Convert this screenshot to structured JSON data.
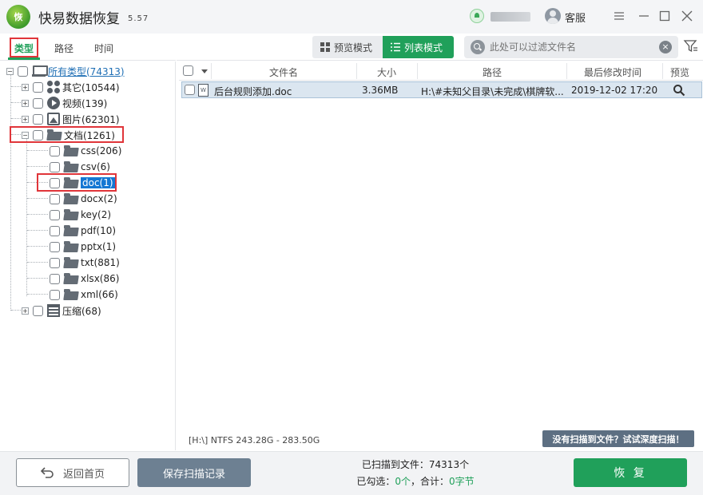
{
  "app": {
    "logo_text": "恢",
    "title": "快易数据恢复",
    "version": "5.57",
    "customer_service": "客服"
  },
  "left_tabs": [
    "类型",
    "路径",
    "时间"
  ],
  "tree": {
    "root": "所有类型(74313)",
    "categories": [
      {
        "label": "其它(10544)",
        "icon": "apps-icon"
      },
      {
        "label": "视频(139)",
        "icon": "video-icon"
      },
      {
        "label": "图片(62301)",
        "icon": "image-icon"
      },
      {
        "label": "文档(1261)",
        "icon": "folder-icon"
      },
      {
        "label": "压缩(68)",
        "icon": "archive-icon"
      }
    ],
    "document_children": [
      "css(206)",
      "csv(6)",
      "doc(1)",
      "docx(2)",
      "key(2)",
      "pdf(10)",
      "pptx(1)",
      "txt(881)",
      "xlsx(86)",
      "xml(66)"
    ],
    "selected": "doc(1)"
  },
  "toolbar": {
    "preview_mode": "预览模式",
    "list_mode": "列表模式",
    "search_placeholder": "此处可以过滤文件名"
  },
  "table": {
    "columns": [
      "文件名",
      "大小",
      "路径",
      "最后修改时间",
      "预览"
    ],
    "rows": [
      {
        "name": "后台规则添加.doc",
        "size": "3.36MB",
        "path": "H:\\#未知父目录\\未完成\\棋牌软...",
        "modified": "2019-12-02  17:20"
      }
    ]
  },
  "status": {
    "path_info": "[H:\\] NTFS 243.28G - 283.50G",
    "deep_scan": "没有扫描到文件？试试深度扫描！"
  },
  "footer": {
    "home_button": "返回首页",
    "save_button": "保存扫描记录",
    "scanned_label": "已扫描到文件：",
    "scanned_count": "74313个",
    "checked_label": "已勾选：",
    "checked_count": "0个",
    "total_label": "，合计：",
    "total_size": "0字节",
    "recover_button": "恢 复"
  },
  "colors": {
    "accent": "#20a05a",
    "selection": "#1477d3",
    "highlight_box": "#e0353a"
  }
}
